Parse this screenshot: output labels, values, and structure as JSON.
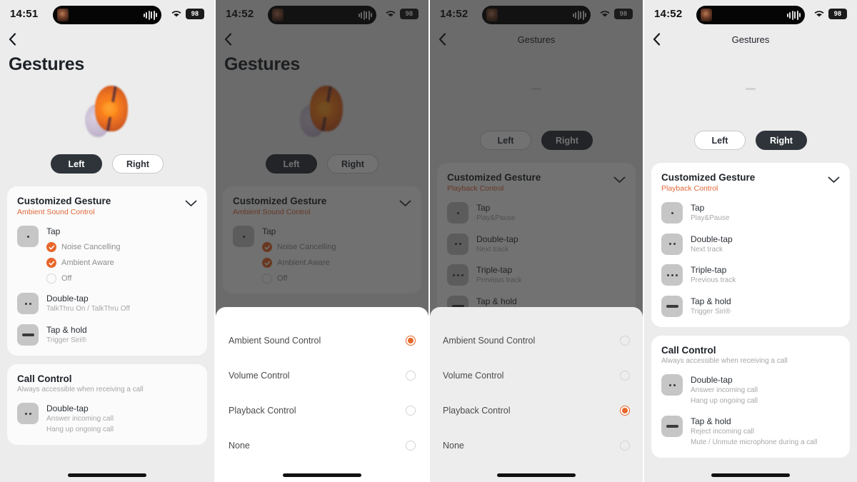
{
  "app": {
    "screen_title": "Gestures",
    "back_icon": "chevron-left-icon",
    "chevron_down_icon": "chevron-down-icon"
  },
  "panels": [
    {
      "id": "panel-1",
      "status": {
        "time": "14:51",
        "battery": "98",
        "wifi_icon": "wifi-icon",
        "island_art_icon": "album-art-icon",
        "island_wave_icon": "audio-waveform-icon"
      },
      "title_style": "large",
      "title": "Gestures",
      "toggle": {
        "left_label": "Left",
        "right_label": "Right",
        "selected": "Left"
      },
      "dimmed": false,
      "sheet": null,
      "cards": [
        {
          "title": "Customized Gesture",
          "subtitle": "Ambient Sound Control",
          "subtitle_color": "#e0673a",
          "has_chevron": true,
          "rows": [
            {
              "icon": "tap-icon",
              "dots": 1,
              "label": "Tap",
              "desc": "",
              "options": [
                {
                  "label": "Noise Cancelling",
                  "checked": true
                },
                {
                  "label": "Ambient Aware",
                  "checked": true
                },
                {
                  "label": "Off",
                  "checked": false
                }
              ]
            },
            {
              "icon": "double-tap-icon",
              "dots": 2,
              "label": "Double-tap",
              "desc": "TalkThru On / TalkThru Off",
              "options": []
            },
            {
              "icon": "tap-hold-icon",
              "dots": 0,
              "label": "Tap & hold",
              "desc": "Trigger Siri®",
              "options": []
            }
          ]
        },
        {
          "title": "Call Control",
          "subtitle": "Always accessible when receiving a call",
          "subtitle_color": "#a6a6a6",
          "has_chevron": false,
          "rows": [
            {
              "icon": "double-tap-icon",
              "dots": 2,
              "label": "Double-tap",
              "desc": "Answer incoming call\nHang up ongoing call",
              "options": []
            }
          ]
        }
      ]
    },
    {
      "id": "panel-2",
      "status": {
        "time": "14:52",
        "battery": "98",
        "wifi_icon": "wifi-icon",
        "island_art_icon": "album-art-icon",
        "island_wave_icon": "audio-waveform-icon"
      },
      "title_style": "large",
      "title": "Gestures",
      "toggle": {
        "left_label": "Left",
        "right_label": "Right",
        "selected": "Left"
      },
      "dimmed": true,
      "sheet": {
        "background": "white",
        "options": [
          {
            "label": "Ambient Sound Control",
            "selected": true
          },
          {
            "label": "Volume Control",
            "selected": false
          },
          {
            "label": "Playback Control",
            "selected": false
          },
          {
            "label": "None",
            "selected": false
          }
        ]
      },
      "cards": [
        {
          "title": "Customized Gesture",
          "subtitle": "Ambient Sound Control",
          "subtitle_color": "#e0673a",
          "has_chevron": true,
          "rows": [
            {
              "icon": "tap-icon",
              "dots": 1,
              "label": "Tap",
              "desc": "",
              "options": [
                {
                  "label": "Noise Cancelling",
                  "checked": true
                },
                {
                  "label": "Ambient Aware",
                  "checked": true
                },
                {
                  "label": "Off",
                  "checked": false
                }
              ]
            }
          ]
        }
      ]
    },
    {
      "id": "panel-3",
      "status": {
        "time": "14:52",
        "battery": "98",
        "wifi_icon": "wifi-icon",
        "island_art_icon": "album-art-icon",
        "island_wave_icon": "audio-waveform-icon"
      },
      "title_style": "small",
      "title": "Gestures",
      "toggle": {
        "left_label": "Left",
        "right_label": "Right",
        "selected": "Right"
      },
      "dimmed": true,
      "sheet": {
        "background": "grey",
        "options": [
          {
            "label": "Ambient Sound Control",
            "selected": false
          },
          {
            "label": "Volume Control",
            "selected": false
          },
          {
            "label": "Playback Control",
            "selected": true
          },
          {
            "label": "None",
            "selected": false
          }
        ]
      },
      "cards": [
        {
          "title": "Customized Gesture",
          "subtitle": "Playback Control",
          "subtitle_color": "#e0673a",
          "has_chevron": true,
          "rows": [
            {
              "icon": "tap-icon",
              "dots": 1,
              "label": "Tap",
              "desc": "Play&Pause",
              "options": []
            },
            {
              "icon": "double-tap-icon",
              "dots": 2,
              "label": "Double-tap",
              "desc": "Next track",
              "options": []
            },
            {
              "icon": "triple-tap-icon",
              "dots": 3,
              "label": "Triple-tap",
              "desc": "Previous track",
              "options": []
            },
            {
              "icon": "tap-hold-icon",
              "dots": 0,
              "label": "Tap & hold",
              "desc": "Trigger Siri®",
              "options": []
            }
          ]
        }
      ]
    },
    {
      "id": "panel-4",
      "status": {
        "time": "14:52",
        "battery": "98",
        "wifi_icon": "wifi-icon",
        "island_art_icon": "album-art-icon",
        "island_wave_icon": "audio-waveform-icon"
      },
      "title_style": "small",
      "title": "Gestures",
      "toggle": {
        "left_label": "Left",
        "right_label": "Right",
        "selected": "Right"
      },
      "dimmed": false,
      "sheet": null,
      "cards": [
        {
          "title": "Customized Gesture",
          "subtitle": "Playback Control",
          "subtitle_color": "#e0673a",
          "has_chevron": true,
          "rows": [
            {
              "icon": "tap-icon",
              "dots": 1,
              "label": "Tap",
              "desc": "Play&Pause",
              "options": []
            },
            {
              "icon": "double-tap-icon",
              "dots": 2,
              "label": "Double-tap",
              "desc": "Next track",
              "options": []
            },
            {
              "icon": "triple-tap-icon",
              "dots": 3,
              "label": "Triple-tap",
              "desc": "Previous track",
              "options": []
            },
            {
              "icon": "tap-hold-icon",
              "dots": 0,
              "label": "Tap & hold",
              "desc": "Trigger Siri®",
              "options": []
            }
          ]
        },
        {
          "title": "Call Control",
          "subtitle": "Always accessible when receiving a call",
          "subtitle_color": "#a6a6a6",
          "has_chevron": false,
          "rows": [
            {
              "icon": "double-tap-icon",
              "dots": 2,
              "label": "Double-tap",
              "desc": "Answer incoming call\nHang up ongoing call",
              "options": []
            },
            {
              "icon": "tap-hold-icon",
              "dots": 0,
              "label": "Tap & hold",
              "desc": "Reject incoming call\nMute / Unmute microphone during a call",
              "options": []
            }
          ]
        }
      ]
    }
  ],
  "colors": {
    "accent_orange": "#e8672b",
    "toggle_dark": "#2e343a",
    "page_bg": "#ececec",
    "card_bg": "#fbfbfb"
  }
}
